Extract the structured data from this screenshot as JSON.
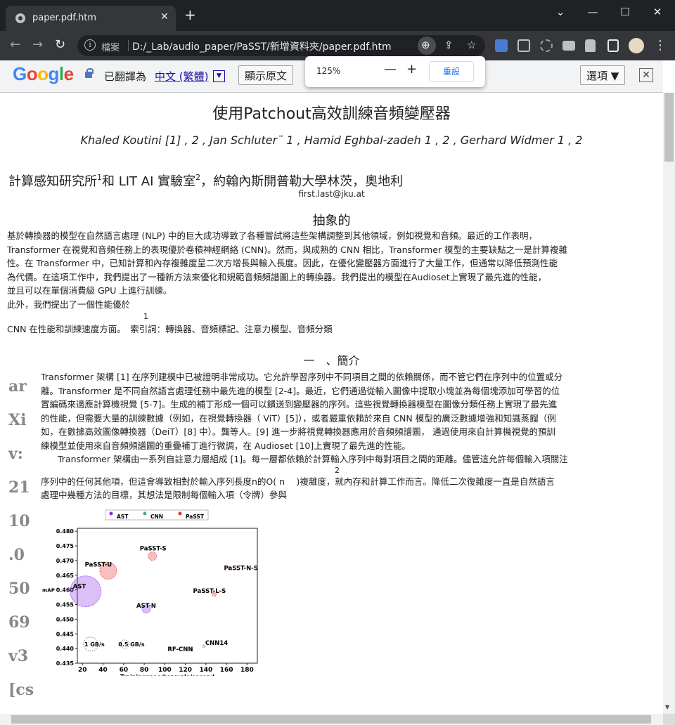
{
  "browser": {
    "tab_title": "paper.pdf.htm",
    "tab_close": "✕",
    "newtab": "+",
    "back": "←",
    "forward": "→",
    "reload": "↻",
    "omnibox_label": "檔案",
    "url": "D:/_Lab/audio_paper/PaSST/新增資料夾/paper.pdf.htm",
    "window_minimize": "—",
    "window_maximize": "☐",
    "window_close": "✕",
    "tablist_chevron": "⌄",
    "menu": "⋮",
    "zoom_icon": "⊕",
    "share_icon": "⇪",
    "star_icon": "☆"
  },
  "zoom_popup": {
    "value": "125%",
    "minus": "—",
    "plus": "+",
    "reset": "重設"
  },
  "translate_bar": {
    "translated_as": "已翻譯為",
    "language": "中文 (繁體)",
    "dropdown": "▼",
    "show_original": "顯示原文",
    "options": "選項 ▼",
    "close": "✕"
  },
  "paper": {
    "title": "使用Patchout高效訓練音頻變壓器",
    "authors": "Khaled Koutini [1] , 2 , Jan Schluter¨ 1 , Hamid Eghbal-zadeh 1 , 2 , Gerhard Widmer 1 , 2",
    "affiliation_a": "計算感知研究所",
    "affiliation_sup1": "1",
    "affiliation_b": "和 LIT AI 實驗室",
    "affiliation_sup2": "2",
    "affiliation_c": "，約翰內斯開普勒大學林茨，奧地利",
    "email": "first.last@jku.at",
    "abstract_title": "抽象的",
    "abstract_lines": [
      "基於轉換器的模型在自然語言處理 (NLP) 中的巨大成功導致了各種嘗試將這些架構調整到其他領域，例如視覺和音頻。最近的工作表明，",
      "Transformer 在視覺和音頻任務上的表現優於卷積神經網絡 (CNN)。然而，與成熟的 CNN 相比，Transformer 模型的主要缺點之一是計算複雜",
      "性。在 Transformer 中，已知計算和內存複雜度呈二次方增長與輸入長度。因此，在優化變壓器方面進行了大量工作，但通常以降低預測性能",
      "為代價。在這項工作中，我們提出了一種新方法來優化和規範音頻頻譜圖上的轉換器。我們提出的模型在Audioset上實現了最先進的性能，",
      "並且可以在單個消費級 GPU 上進行訓練。",
      "此外，我們提出了一個性能優於"
    ],
    "footnote_mark": "1",
    "abstract_last": "CNN 在性能和訓練速度方面。　索引詞：轉換器、音頻標記、注意力模型、音頻分類",
    "section_title": "一　、簡介",
    "body_lines": [
      "Transformer 架構 [1] 在序列建模中已被證明非常成功。它允許學習序列中不同項目之間的依賴關係，而不管它們在序列中的位置或分",
      "離。Transformer 是不同自然語言處理任務中最先進的模型 [2-4]。最近，它們通過從輸入圖像中提取小塊並為每個塊添加可學習的位",
      "置編碼來適應計算機視覺 [5-7]。生成的補丁形成一個可以饋送到變壓器的序列。這些視覺轉換器模型在圖像分類任務上實現了最先進",
      "的性能，但需要大量的訓練數據（例如，在視覺轉換器（ ViT）[5]），或者嚴重依賴於來自 CNN 模型的廣泛數據增強和知識蒸餾（例",
      "如，在數據高效圖像轉換器（DeiT）[8] 中）。龔等人。[9] 進一步將視覺轉換器應用於音頻頻譜圖， 通過使用來自計算機視覺的預訓",
      "練模型並使用來自音頻頻譜圖的重疊補丁進行微調，在 Audioset [10]上實現了最先進的性能。"
    ],
    "body_para2": "Transformer 架構由一系列自註意力層組成 [1]。每一層都依賴於計算輸入序列中每對項目之間的距離。儘管這允許每個輸入項關注",
    "body_exp": "2",
    "body_line3": "序列中的任何其他項，但這會導致相對於輸入序列長度n的O( n 　)複雜度，就內存和計算工作而言。降低二次復雜度一直是自然語言",
    "body_line4": "處理中幾種方法的目標，其想法是限制每個輸入項（令牌）參與",
    "arxiv_side": [
      "ar",
      "Xi",
      "v:",
      "21",
      "10",
      ".0",
      "50",
      "69",
      "v3",
      "[cs"
    ]
  },
  "chart_data": {
    "type": "scatter",
    "title": "",
    "xlabel": "Trainingspeed:sample/second",
    "ylabel": "mAP",
    "xlim": [
      15,
      190
    ],
    "ylim": [
      0.435,
      0.481
    ],
    "xticks": [
      20,
      40,
      60,
      80,
      100,
      120,
      140,
      160,
      180
    ],
    "yticks": [
      0.435,
      0.44,
      0.445,
      0.45,
      0.455,
      0.46,
      0.465,
      0.47,
      0.475,
      0.48
    ],
    "legend": [
      "AST",
      "CNN",
      "PaSST"
    ],
    "legend_placement": "top",
    "series_colors": {
      "AST": "#8a2be2",
      "CNN": "#3cb371",
      "PaSST": "#e63030",
      "memory": "#888888"
    },
    "points": [
      {
        "label": "AST",
        "x": 23,
        "y": 0.4595,
        "series": "AST",
        "size": 22
      },
      {
        "label": "AST-N",
        "x": 82,
        "y": 0.4535,
        "series": "AST",
        "size": 6
      },
      {
        "label": "PaSST-U",
        "x": 45,
        "y": 0.4665,
        "series": "PaSST",
        "size": 12
      },
      {
        "label": "PaSST-S",
        "x": 88,
        "y": 0.4715,
        "series": "PaSST",
        "size": 6
      },
      {
        "label": "PaSST-N-S",
        "x": 163,
        "y": 0.4675,
        "series": "PaSST",
        "size": 2
      },
      {
        "label": "PaSST-L-S",
        "x": 148,
        "y": 0.4585,
        "series": "PaSST",
        "size": 3
      },
      {
        "label": "RF-CNN",
        "x": 126,
        "y": 0.4395,
        "series": "CNN",
        "size": 2
      },
      {
        "label": "CNN14",
        "x": 138,
        "y": 0.4408,
        "series": "CNN",
        "size": 2
      }
    ],
    "memory_legend": [
      {
        "label": "1  GB/s",
        "x": 28,
        "y": 0.4415,
        "size": 10
      },
      {
        "label": "0.5  GB/s",
        "x": 61,
        "y": 0.4415,
        "size": 6
      }
    ]
  }
}
